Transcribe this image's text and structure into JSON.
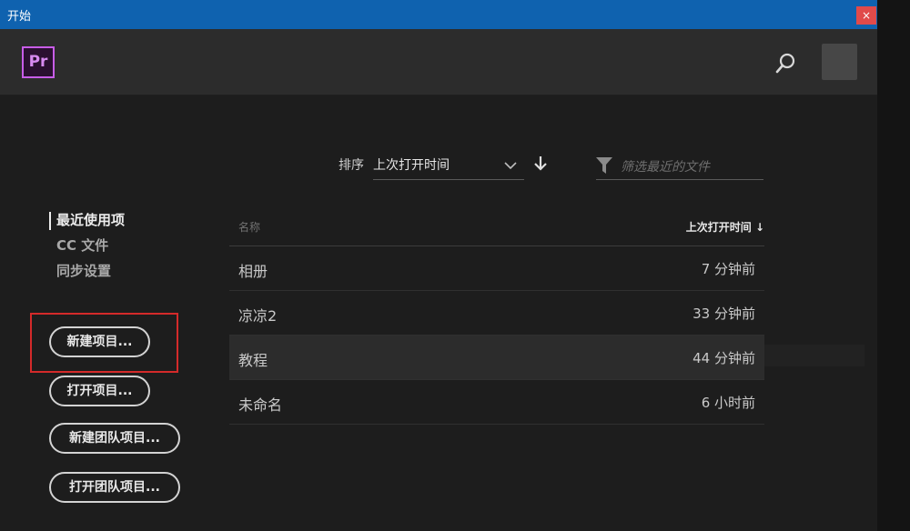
{
  "window": {
    "title": "开始",
    "close_label": "×"
  },
  "header": {
    "logo_text": "Pr"
  },
  "toolbar": {
    "sort_label": "排序",
    "sort_value": "上次打开时间",
    "filter_placeholder": "筛选最近的文件"
  },
  "nav": {
    "items": [
      {
        "label": "最近使用项",
        "active": true
      },
      {
        "label": "CC 文件",
        "active": false
      },
      {
        "label": "同步设置",
        "active": false
      }
    ]
  },
  "buttons": {
    "new_project": "新建项目...",
    "open_project": "打开项目...",
    "new_team_project": "新建团队项目...",
    "open_team_project": "打开团队项目..."
  },
  "table": {
    "col_name": "名称",
    "col_time": "上次打开时间 ↓",
    "rows": [
      {
        "name": "相册",
        "time": "7 分钟前"
      },
      {
        "name": "凉凉2",
        "time": "33 分钟前"
      },
      {
        "name": "教程",
        "time": "44 分钟前"
      },
      {
        "name": "未命名",
        "time": "6 小时前"
      }
    ]
  },
  "colors": {
    "titlebar": "#0f62af",
    "close": "#e04a4a",
    "accent": "#c85de8",
    "highlight": "#d42a2a"
  },
  "icons": [
    "search-icon",
    "chevron-down-icon",
    "arrow-down-icon",
    "filter-icon",
    "close-icon"
  ]
}
